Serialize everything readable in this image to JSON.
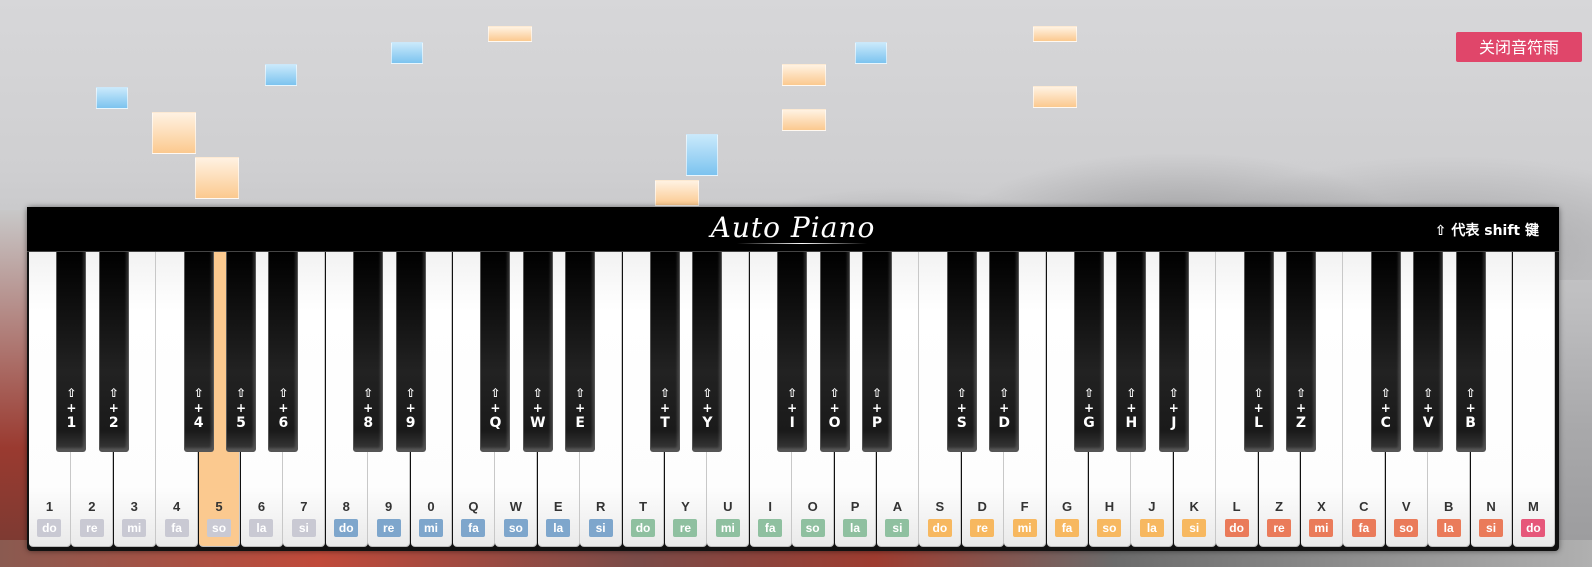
{
  "toggle_button": "关闭音符雨",
  "title": "Auto Piano",
  "shift_hint": "⇧ 代表 shift 键",
  "shift_symbol": "⇧",
  "plus": "+",
  "colors": {
    "do_group1": "#bdbdc9",
    "group2": "#7ea6cc",
    "group3": "#8fc0a0",
    "group4": "#f7b860",
    "group5": "#ea7b5a",
    "last_do": "#e6577a"
  },
  "white_keys": [
    {
      "key": "1",
      "note": "do",
      "color": "#c9c9d3"
    },
    {
      "key": "2",
      "note": "re",
      "color": "#c9c9d3"
    },
    {
      "key": "3",
      "note": "mi",
      "color": "#c9c9d3"
    },
    {
      "key": "4",
      "note": "fa",
      "color": "#c9c9d3"
    },
    {
      "key": "5",
      "note": "so",
      "color": "#c9c9d3",
      "active": true
    },
    {
      "key": "6",
      "note": "la",
      "color": "#c9c9d3"
    },
    {
      "key": "7",
      "note": "si",
      "color": "#c9c9d3"
    },
    {
      "key": "8",
      "note": "do",
      "color": "#7ea6cc"
    },
    {
      "key": "9",
      "note": "re",
      "color": "#7ea6cc"
    },
    {
      "key": "0",
      "note": "mi",
      "color": "#7ea6cc"
    },
    {
      "key": "Q",
      "note": "fa",
      "color": "#7ea6cc"
    },
    {
      "key": "W",
      "note": "so",
      "color": "#7ea6cc"
    },
    {
      "key": "E",
      "note": "la",
      "color": "#7ea6cc"
    },
    {
      "key": "R",
      "note": "si",
      "color": "#7ea6cc"
    },
    {
      "key": "T",
      "note": "do",
      "color": "#8fc0a0"
    },
    {
      "key": "Y",
      "note": "re",
      "color": "#8fc0a0"
    },
    {
      "key": "U",
      "note": "mi",
      "color": "#8fc0a0"
    },
    {
      "key": "I",
      "note": "fa",
      "color": "#8fc0a0"
    },
    {
      "key": "O",
      "note": "so",
      "color": "#8fc0a0"
    },
    {
      "key": "P",
      "note": "la",
      "color": "#8fc0a0"
    },
    {
      "key": "A",
      "note": "si",
      "color": "#8fc0a0"
    },
    {
      "key": "S",
      "note": "do",
      "color": "#f7b860"
    },
    {
      "key": "D",
      "note": "re",
      "color": "#f7b860"
    },
    {
      "key": "F",
      "note": "mi",
      "color": "#f7b860"
    },
    {
      "key": "G",
      "note": "fa",
      "color": "#f7b860"
    },
    {
      "key": "H",
      "note": "so",
      "color": "#f7b860"
    },
    {
      "key": "J",
      "note": "la",
      "color": "#f7b860"
    },
    {
      "key": "K",
      "note": "si",
      "color": "#f7b860"
    },
    {
      "key": "L",
      "note": "do",
      "color": "#ea7b5a"
    },
    {
      "key": "Z",
      "note": "re",
      "color": "#ea7b5a"
    },
    {
      "key": "X",
      "note": "mi",
      "color": "#ea7b5a"
    },
    {
      "key": "C",
      "note": "fa",
      "color": "#ea7b5a"
    },
    {
      "key": "V",
      "note": "so",
      "color": "#ea7b5a"
    },
    {
      "key": "B",
      "note": "la",
      "color": "#ea7b5a"
    },
    {
      "key": "N",
      "note": "si",
      "color": "#ea7b5a"
    },
    {
      "key": "M",
      "note": "do",
      "color": "#e6577a"
    }
  ],
  "black_keys": [
    {
      "key": "1"
    },
    {
      "key": "2"
    },
    {
      "key": "4"
    },
    {
      "key": "5"
    },
    {
      "key": "6"
    },
    {
      "key": "8"
    },
    {
      "key": "9"
    },
    {
      "key": "Q"
    },
    {
      "key": "W"
    },
    {
      "key": "E"
    },
    {
      "key": "T"
    },
    {
      "key": "Y"
    },
    {
      "key": "I"
    },
    {
      "key": "O"
    },
    {
      "key": "P"
    },
    {
      "key": "S"
    },
    {
      "key": "D"
    },
    {
      "key": "G"
    },
    {
      "key": "H"
    },
    {
      "key": "J"
    },
    {
      "key": "L"
    },
    {
      "key": "Z"
    },
    {
      "key": "C"
    },
    {
      "key": "V"
    },
    {
      "key": "B"
    }
  ],
  "falling_notes": [
    {
      "color": "blue"
    },
    {
      "color": "orange"
    },
    {
      "color": "orange"
    },
    {
      "color": "blue"
    },
    {
      "color": "blue"
    },
    {
      "color": "orange"
    },
    {
      "color": "orange"
    },
    {
      "color": "blue"
    },
    {
      "color": "orange"
    },
    {
      "color": "orange"
    },
    {
      "color": "blue"
    },
    {
      "color": "orange"
    },
    {
      "color": "orange"
    }
  ]
}
